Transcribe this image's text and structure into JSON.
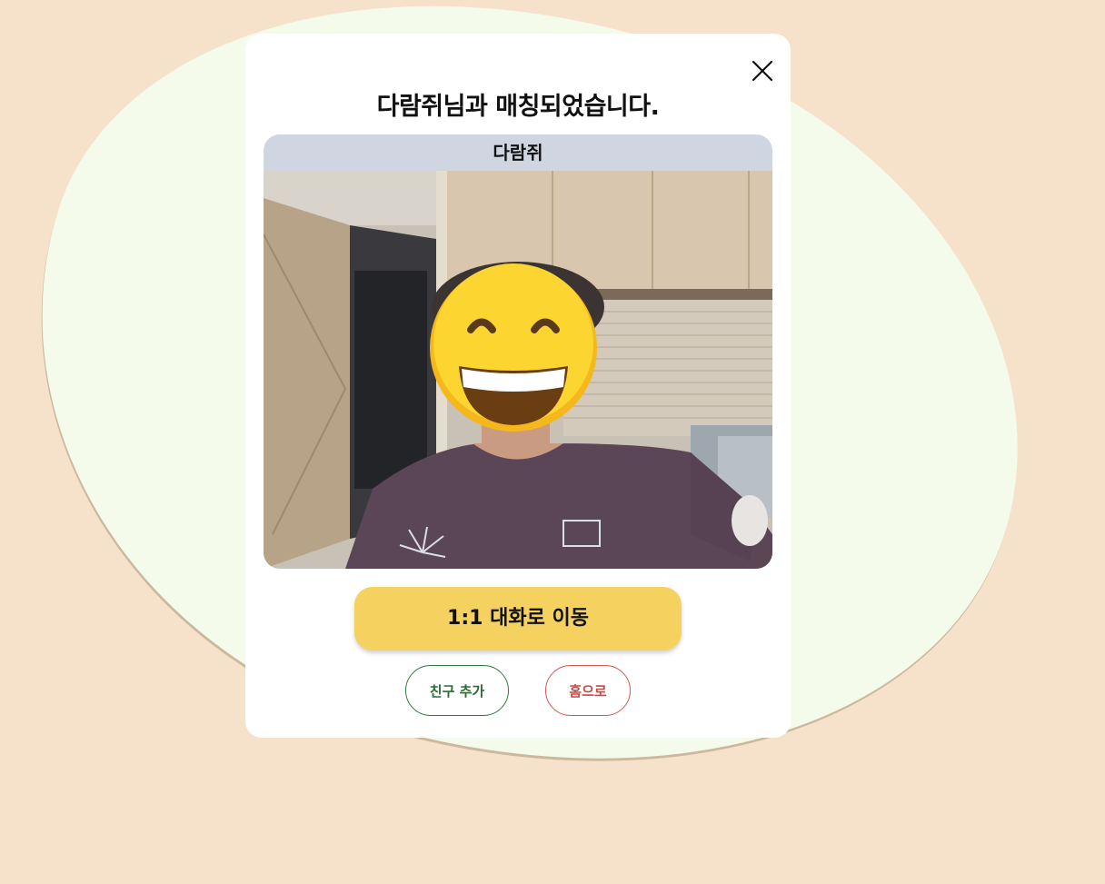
{
  "modal": {
    "title": "다람쥐님과 매칭되었습니다.",
    "close_icon": "close-icon"
  },
  "video": {
    "participant_name": "다람쥐",
    "face_overlay_icon": "grinning-face-emoji-icon"
  },
  "actions": {
    "primary_label": "1:1 대화로 이동",
    "add_friend_label": "친구 추가",
    "home_label": "홈으로"
  },
  "colors": {
    "page_background": "#f6e2cb",
    "blob": "#f4fbea",
    "primary_button": "#f5d160",
    "name_bar": "#cfd6e2",
    "add_friend_accent": "#2f7a3b",
    "home_accent": "#d9534f"
  }
}
